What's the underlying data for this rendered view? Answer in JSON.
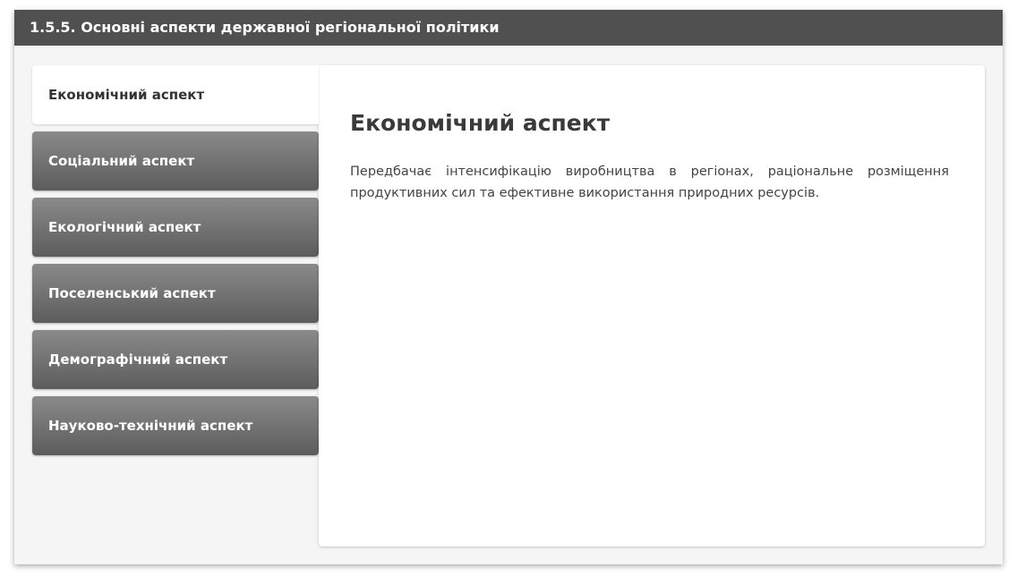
{
  "window": {
    "title": "1.5.5. Основні аспекти державної регіональної політики"
  },
  "tabs": [
    {
      "label": "Економічний аспект",
      "active": true
    },
    {
      "label": "Соціальний аспект",
      "active": false
    },
    {
      "label": "Екологічний аспект",
      "active": false
    },
    {
      "label": "Поселенський аспект",
      "active": false
    },
    {
      "label": "Демографічний аспект",
      "active": false
    },
    {
      "label": "Науково-технічний аспект",
      "active": false
    }
  ],
  "content": {
    "title": "Економічний аспект",
    "text": "Передбачає інтенсифікацію виробництва в регіонах, раціональне розміщення продуктивних сил та ефективне використання природних ресурсів."
  },
  "colors": {
    "title_bar": "#505050",
    "tab_inactive_top": "#8a8a8a",
    "tab_inactive_bottom": "#5c5c5c",
    "background": "#f5f5f5"
  }
}
